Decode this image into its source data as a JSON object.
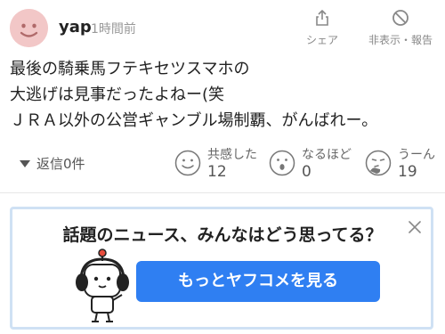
{
  "comment": {
    "username": "yap",
    "time": "1時間前",
    "share_label": "シェア",
    "hide_report_label": "非表示・報告",
    "body_lines": [
      "最後の騎乗馬フテキセツスマホの",
      "大逃げは見事だったよねー(笑",
      "ＪＲＡ以外の公営ギャンブル場制覇、がんばれー。"
    ],
    "replies_label": "返信",
    "replies_count": "0件"
  },
  "reactions": [
    {
      "icon": "smile-face-icon",
      "label": "共感した",
      "count": "12"
    },
    {
      "icon": "surprised-face-icon",
      "label": "なるほど",
      "count": "0"
    },
    {
      "icon": "thinking-face-icon",
      "label": "うーん",
      "count": "19"
    }
  ],
  "promo": {
    "title": "話題のニュース、みんなはどう思ってる？",
    "button_label": "もっとヤフコメを見る"
  },
  "colors": {
    "accent": "#2f7ff2",
    "avatar_bg": "#f2c7c7",
    "promo_border": "#cfe1f4"
  }
}
